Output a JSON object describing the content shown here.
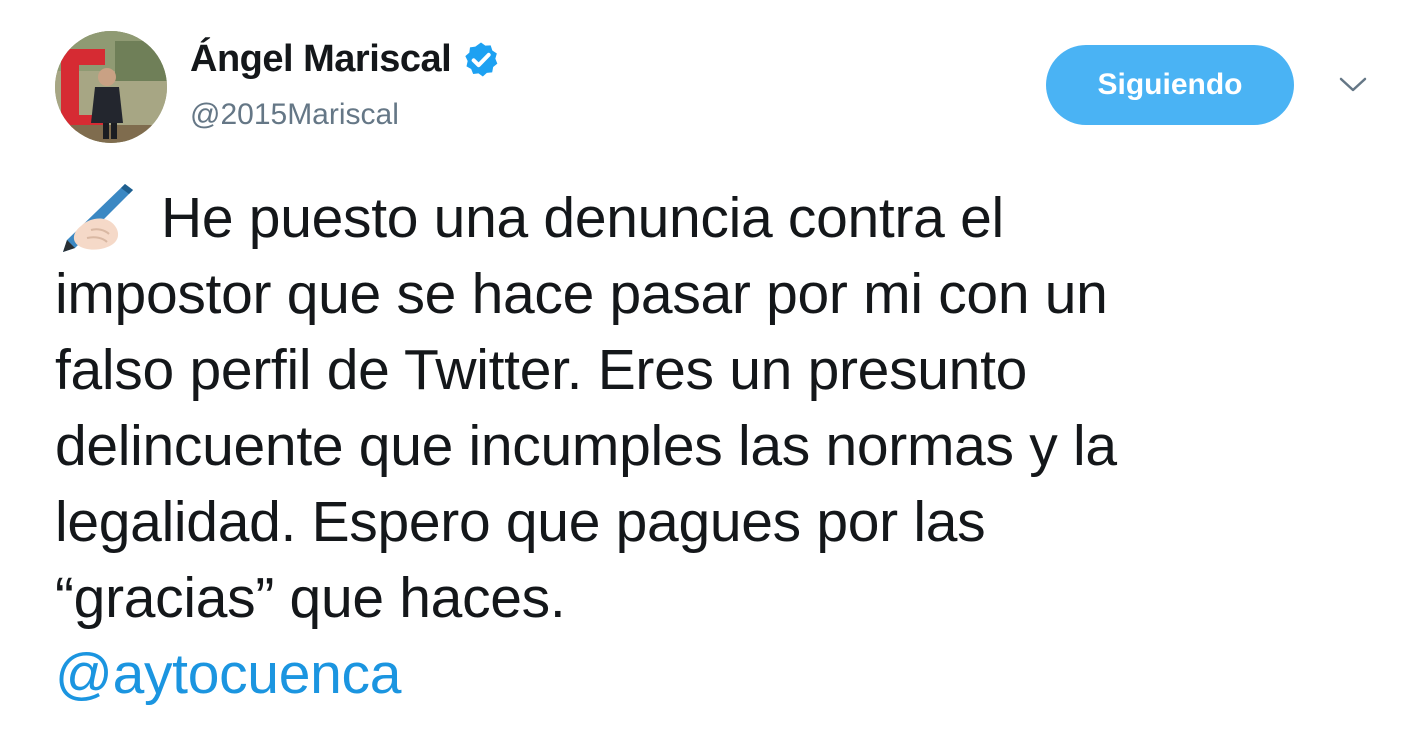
{
  "author": {
    "display_name": "Ángel Mariscal",
    "handle": "@2015Mariscal",
    "verified": true,
    "avatar_icon": "profile-avatar"
  },
  "follow_button": {
    "label": "Siguiendo"
  },
  "menu_icon": "chevron-down-icon",
  "tweet": {
    "lead_emoji": "writing-hand-icon",
    "lines": [
      "He puesto una denuncia contra el",
      "impostor que se hace pasar por mi con un",
      "falso perfil de Twitter. Eres un presunto",
      "delincuente que incumples las normas y la",
      "legalidad. Espero que pagues por las",
      "“gracias” que haces."
    ],
    "mention": "@aytocuenca"
  },
  "colors": {
    "text": "#14171a",
    "secondary_text": "#657786",
    "follow_button_bg": "#4ab3f4",
    "link": "#1b95e0",
    "verified_badge": "#1da1f2"
  }
}
